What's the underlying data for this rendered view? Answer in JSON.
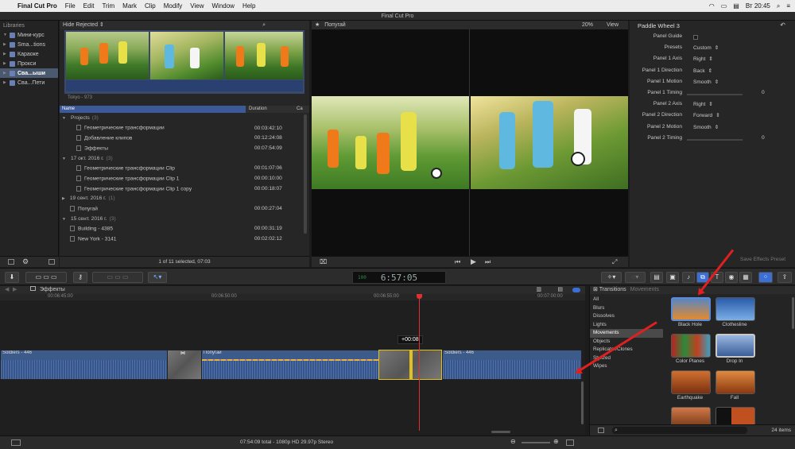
{
  "menubar": {
    "apple": "",
    "app": "Final Cut Pro",
    "items": [
      "File",
      "Edit",
      "Trim",
      "Mark",
      "Clip",
      "Modify",
      "View",
      "Window",
      "Help"
    ],
    "clock": "Вт 20:45"
  },
  "window_title": "Final Cut Pro",
  "libraries": {
    "header": "Libraries",
    "items": [
      {
        "label": "Мини-курс"
      },
      {
        "label": "Sma...tions"
      },
      {
        "label": "Караоке"
      },
      {
        "label": "Прокси"
      },
      {
        "label": "Сва...ыши"
      },
      {
        "label": "Сва...Пети"
      }
    ]
  },
  "browser": {
    "filter": "Hide Rejected",
    "thumb_caption": "Tokyo - 973",
    "col_name": "Name",
    "col_duration": "Duration",
    "col_extra": "Ca",
    "rows": [
      {
        "name": "Projects",
        "count": "(3)",
        "duration": ""
      },
      {
        "name": "Геометрические трансформации",
        "count": "",
        "duration": "00:03:42:10"
      },
      {
        "name": "Добавление клипов",
        "count": "",
        "duration": "00:12:24:08"
      },
      {
        "name": "Эффекты",
        "count": "",
        "duration": "00:07:54:09"
      },
      {
        "name": "17 окт. 2016 г.",
        "count": "(3)",
        "duration": ""
      },
      {
        "name": "Геометрические трансформации Clip",
        "count": "",
        "duration": "00:01:07:06"
      },
      {
        "name": "Геометрические трансформации Clip 1",
        "count": "",
        "duration": "00:00:10:00"
      },
      {
        "name": "Геометрические трансформации Clip 1 copy",
        "count": "",
        "duration": "00:00:18:07"
      },
      {
        "name": "19 сент. 2016 г.",
        "count": "(1)",
        "duration": ""
      },
      {
        "name": "Попугай",
        "count": "",
        "duration": "00:00:27:04"
      },
      {
        "name": "15 сент. 2016 г.",
        "count": "(3)",
        "duration": ""
      },
      {
        "name": "Building - 4385",
        "count": "",
        "duration": "00:00:31:19"
      },
      {
        "name": "New York - 3141",
        "count": "",
        "duration": "00:02:02:12"
      }
    ],
    "status": "1 of 11 selected, 07:03"
  },
  "viewer": {
    "title": "Попугай",
    "zoom": "20%",
    "view": "View"
  },
  "inspector": {
    "title": "Paddle Wheel 3",
    "rows": [
      {
        "label": "Panel Guide",
        "value": ""
      },
      {
        "label": "Presets",
        "value": "Custom"
      },
      {
        "label": "Panel 1 Axis",
        "value": "Right"
      },
      {
        "label": "Panel 1 Direction",
        "value": "Back"
      },
      {
        "label": "Panel 1 Motion",
        "value": "Smooth"
      },
      {
        "label": "Panel 1 Timing",
        "value": "0"
      },
      {
        "label": "Panel 2 Axis",
        "value": "Right"
      },
      {
        "label": "Panel 2 Direction",
        "value": "Forward"
      },
      {
        "label": "Panel 2 Motion",
        "value": "Smooth"
      },
      {
        "label": "Panel 2 Timing",
        "value": "0"
      }
    ],
    "save_preset": "Save Effects Preset"
  },
  "timecode": "6:57:05",
  "timecode_prefix": "100",
  "timeline": {
    "project": "Эффекты",
    "ruler": [
      "00:06:45:00",
      "00:06:50:00",
      "00:06:55:00",
      "00:07:00:00"
    ],
    "clips": [
      {
        "label": "Soldiers - 446"
      },
      {
        "label": "Попугай"
      },
      {
        "label": "Soldiers - 446"
      }
    ],
    "tooltip": "+00:08"
  },
  "transitions": {
    "title": "Transitions",
    "crumb": "Movements",
    "categories": [
      "All",
      "Blurs",
      "Dissolves",
      "Lights",
      "Movements",
      "Objects",
      "Replicator/Clones",
      "Stylized",
      "Wipes"
    ],
    "selected_category": "Movements",
    "tiles": [
      {
        "label": "Black Hole"
      },
      {
        "label": "Clothesline"
      },
      {
        "label": "Color Planes"
      },
      {
        "label": "Drop In"
      },
      {
        "label": "Earthquake"
      },
      {
        "label": "Fall"
      }
    ],
    "count": "24 items"
  },
  "footer": {
    "status": "07:54:09 total - 1080p HD 29.97p Stereo"
  }
}
